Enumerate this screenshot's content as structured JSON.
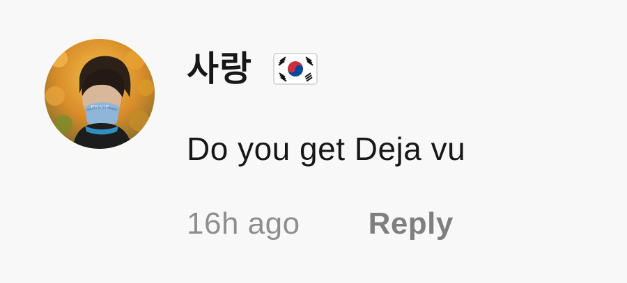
{
  "comment": {
    "avatar_icon": "user-avatar",
    "username": "사랑",
    "flag_icon": "south-korea-flag-icon",
    "text": "Do you get Deja vu",
    "timestamp": "16h ago",
    "reply_label": "Reply"
  },
  "colors": {
    "background": "#f8f8f8",
    "primary_text": "#171717",
    "secondary_text": "#8e8e8e",
    "reply_text": "#7f7f7f"
  }
}
